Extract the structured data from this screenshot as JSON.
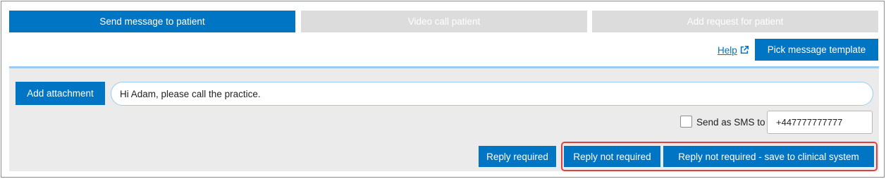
{
  "tabs": [
    {
      "label": "Send message to patient",
      "state": "active"
    },
    {
      "label": "Video call patient",
      "state": "disabled"
    },
    {
      "label": "Add request for patient",
      "state": "disabled"
    }
  ],
  "help": {
    "label": "Help",
    "icon": "external-link-icon"
  },
  "pick_template": {
    "label": "Pick message template"
  },
  "compose": {
    "attach_label": "Add attachment",
    "message_value": "Hi Adam, please call the practice.",
    "sms": {
      "label": "Send as SMS to",
      "checked": false,
      "phone_value": "+447777777777"
    }
  },
  "actions": {
    "reply_required": "Reply required",
    "reply_not_required": "Reply not required",
    "reply_not_required_save": "Reply not required - save to clinical system"
  },
  "colors": {
    "primary": "#0075c4",
    "disabled_tab": "#dcdcdc",
    "panel_bg": "#ebebeb",
    "highlight": "#e04040"
  }
}
